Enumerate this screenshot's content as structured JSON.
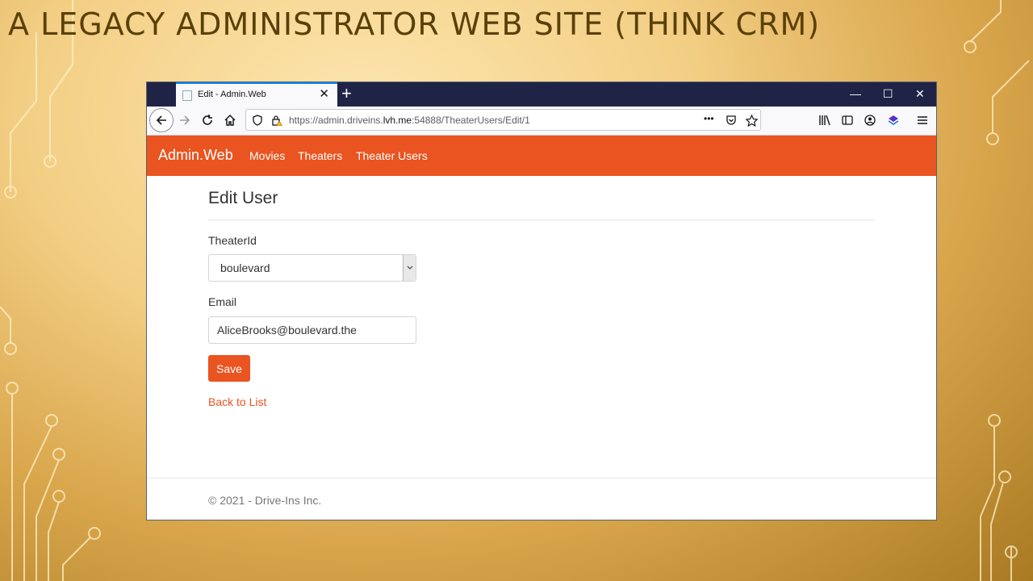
{
  "slide": {
    "title": "A LEGACY ADMINISTRATOR WEB SITE (THINK CRM)"
  },
  "browser": {
    "tab_title": "Edit - Admin.Web",
    "url_prefix": "https://admin.driveins.",
    "url_host": "lvh.me",
    "url_suffix": ":54888/TheaterUsers/Edit/1",
    "page_actions_label": "•••",
    "minimize_glyph": "—",
    "maximize_glyph": "☐",
    "close_glyph": "✕",
    "new_tab_glyph": "+",
    "tab_close_glyph": "✕"
  },
  "app": {
    "brand": "Admin.Web",
    "nav": [
      "Movies",
      "Theaters",
      "Theater Users"
    ],
    "accent_color": "#e95420"
  },
  "form": {
    "heading": "Edit User",
    "theater_label": "TheaterId",
    "theater_value": "boulevard",
    "email_label": "Email",
    "email_value": "AliceBrooks@boulevard.the",
    "save_label": "Save",
    "back_link": "Back to List"
  },
  "footer": {
    "text": "© 2021 - Drive-Ins Inc."
  }
}
